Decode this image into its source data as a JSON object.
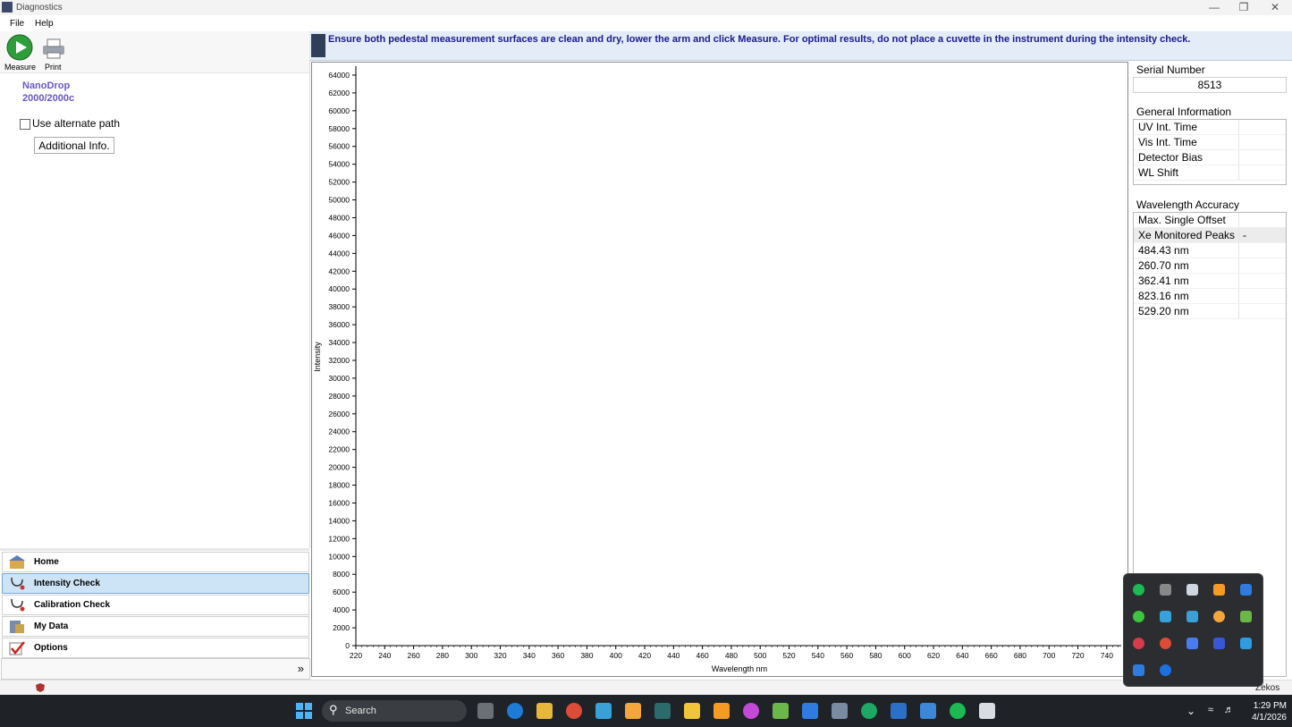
{
  "window": {
    "title": "Diagnostics"
  },
  "menu": {
    "file": "File",
    "help": "Help"
  },
  "toolbar": {
    "measure_label": "Measure",
    "print_label": "Print"
  },
  "instrument": {
    "line1": "NanoDrop",
    "line2": "2000/2000c"
  },
  "options": {
    "alternate_path_label": "Use alternate path",
    "alternate_path_checked": false,
    "additional_info_label": "Additional Info."
  },
  "nav": [
    {
      "label": "Home",
      "active": false
    },
    {
      "label": "Intensity Check",
      "active": true
    },
    {
      "label": "Calibration Check",
      "active": false
    },
    {
      "label": "My Data",
      "active": false
    },
    {
      "label": "Options",
      "active": false
    }
  ],
  "banner": {
    "text": "Ensure both pedestal measurement surfaces are clean and dry, lower the arm and click Measure.  For optimal results, do not place a cuvette in the instrument during the intensity check."
  },
  "serial": {
    "label": "Serial Number",
    "value": "8513"
  },
  "general_info": {
    "label": "General Information",
    "rows": [
      {
        "k": "UV Int. Time",
        "v": ""
      },
      {
        "k": "Vis Int. Time",
        "v": ""
      },
      {
        "k": "Detector Bias",
        "v": ""
      },
      {
        "k": "WL Shift",
        "v": ""
      }
    ]
  },
  "wavelength_accuracy": {
    "label": "Wavelength Accuracy",
    "rows": [
      {
        "k": "Max. Single Offset",
        "v": ""
      },
      {
        "k": "Xe Monitored Peaks",
        "v": "-"
      },
      {
        "k": "484.43 nm",
        "v": ""
      },
      {
        "k": "260.70 nm",
        "v": ""
      },
      {
        "k": "362.41 nm",
        "v": ""
      },
      {
        "k": "823.16 nm",
        "v": ""
      },
      {
        "k": "529.20 nm",
        "v": ""
      }
    ]
  },
  "chart_data": {
    "type": "line",
    "xlabel": "Wavelength nm",
    "ylabel": "Intensity",
    "xlim": [
      220,
      750
    ],
    "ylim": [
      0,
      65000
    ],
    "x_ticks": [
      220,
      240,
      260,
      280,
      300,
      320,
      340,
      360,
      380,
      400,
      420,
      440,
      460,
      480,
      500,
      520,
      540,
      560,
      580,
      600,
      620,
      640,
      660,
      680,
      700,
      720,
      740
    ],
    "y_ticks": [
      0,
      2000,
      4000,
      6000,
      8000,
      10000,
      12000,
      14000,
      16000,
      18000,
      20000,
      22000,
      24000,
      26000,
      28000,
      30000,
      32000,
      34000,
      36000,
      38000,
      40000,
      42000,
      44000,
      46000,
      48000,
      50000,
      52000,
      54000,
      56000,
      58000,
      60000,
      62000,
      64000
    ],
    "series": []
  },
  "taskbar": {
    "search_placeholder": "Search",
    "time": "1:29 PM",
    "date": "4/1/2026"
  },
  "status": {
    "user": "Zekos"
  },
  "colors": {
    "banner_text": "#1a1a8c",
    "instrument_text": "#6a55c8",
    "active_nav": "#cde4f7"
  }
}
